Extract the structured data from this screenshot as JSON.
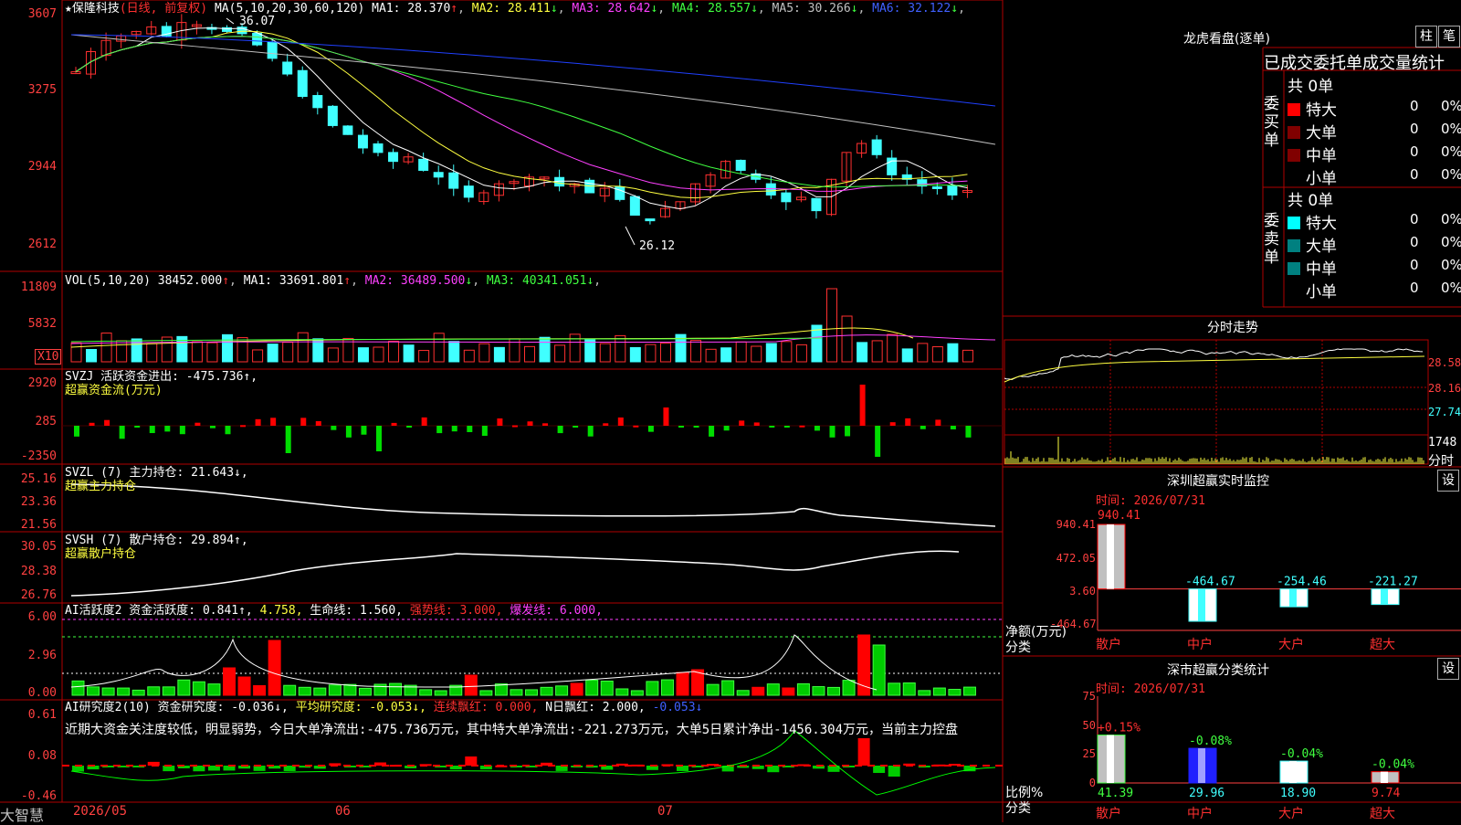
{
  "app": {
    "brand": "大智慧"
  },
  "kline": {
    "title_stock": "★保隆科技",
    "title_mode": "(日线, 前复权)",
    "title_ma": "MA(5,10,20,30,60,120)",
    "ma_values": [
      {
        "label": "MA1:",
        "value": "28.370",
        "arrow": "↑",
        "color": "#ffffff"
      },
      {
        "label": "MA2:",
        "value": "28.411",
        "arrow": "↓",
        "color": "#ffff40"
      },
      {
        "label": "MA3:",
        "value": "28.642",
        "arrow": "↓",
        "color": "#ff40ff"
      },
      {
        "label": "MA4:",
        "value": "28.557",
        "arrow": "↓",
        "color": "#40ff40"
      },
      {
        "label": "MA5:",
        "value": "30.266",
        "arrow": "↓",
        "color": "#c0c0c0"
      },
      {
        "label": "MA6:",
        "value": "32.122",
        "arrow": "↓",
        "color": "#4060ff"
      }
    ],
    "yticks": [
      "3607",
      "3275",
      "2944",
      "2612"
    ],
    "high_label": "36.07",
    "low_label": "26.12"
  },
  "vol": {
    "title": "VOL(5,10,20)",
    "value": "38452.000",
    "ma": [
      {
        "label": "MA1:",
        "value": "33691.801",
        "arrow": "↑",
        "color": "#ffffff"
      },
      {
        "label": "MA2:",
        "value": "36489.500",
        "arrow": "↓",
        "color": "#ff40ff"
      },
      {
        "label": "MA3:",
        "value": "40341.051",
        "arrow": "↓",
        "color": "#40ff40"
      }
    ],
    "yticks": [
      "11809",
      "5832"
    ],
    "unit": "X10"
  },
  "svzj": {
    "title": "SVZJ  活跃资金进出: -475.736↑,",
    "subtitle": "超赢资金流(万元)",
    "yticks": [
      "2920",
      "285",
      "-2350"
    ]
  },
  "svzl": {
    "title": "SVZL (7) 主力持仓: 21.643↓,",
    "subtitle": "超赢主力持仓",
    "yticks": [
      "25.16",
      "23.36",
      "21.56"
    ]
  },
  "svsh": {
    "title": "SVSH (7) 散户持仓: 29.894↑,",
    "subtitle": "超赢散户持仓",
    "yticks": [
      "30.05",
      "28.38",
      "26.76"
    ]
  },
  "ai1": {
    "t1": "AI活跃度2 资金活跃度: 0.841↑,",
    "t2": "4.758,",
    "t3": "生命线: 1.560,",
    "t4": "强势线: 3.000,",
    "t5": "爆发线: 6.000,",
    "yticks": [
      "6.00",
      "2.96",
      "0.00"
    ]
  },
  "ai2": {
    "t1": "AI研究度2(10) 资金研究度: -0.036↓,",
    "t2": "平均研究度: -0.053↓,",
    "t3": "连续飘红: 0.000,",
    "t4": "N日飘红: 2.000,",
    "t5": "-0.053↓",
    "comment": "近期大资金关注度较低，明显弱势，今日大单净流出:-475.736万元，其中特大单净流出:-221.273万元，大单5日累计净出-1456.304万元，当前主力控盘",
    "yticks": [
      "0.61",
      "0.08",
      "-0.46"
    ]
  },
  "xaxis": {
    "labels": [
      "2026/05",
      "06",
      "07"
    ]
  },
  "lhkp": {
    "title": "龙虎看盘(逐单)",
    "btn1": "柱",
    "btn2": "笔",
    "header": "已成交委托单成交量统计",
    "buy_label": "委买单",
    "sell_label": "委卖单",
    "buy_total": "共 0单",
    "sell_total": "共 0单",
    "buy_rows": [
      {
        "name": "特大",
        "count": "0",
        "pct": "0%",
        "color": "#ff0000"
      },
      {
        "name": "大单",
        "count": "0",
        "pct": "0%",
        "color": "#800000"
      },
      {
        "name": "中单",
        "count": "0",
        "pct": "0%",
        "color": "#800000"
      },
      {
        "name": "小单",
        "count": "0",
        "pct": "0%",
        "color": "#000000"
      }
    ],
    "sell_rows": [
      {
        "name": "特大",
        "count": "0",
        "pct": "0%",
        "color": "#00ffff"
      },
      {
        "name": "大单",
        "count": "0",
        "pct": "0%",
        "color": "#008080"
      },
      {
        "name": "中单",
        "count": "0",
        "pct": "0%",
        "color": "#008080"
      },
      {
        "name": "小单",
        "count": "0",
        "pct": "0%",
        "color": "#000000"
      }
    ]
  },
  "intraday": {
    "title": "分时走势",
    "ylabels": [
      "28.58",
      "28.16",
      "27.74"
    ],
    "vol_label": "1748",
    "unit": "分时"
  },
  "sz_monitor": {
    "title": "深圳超赢实时监控",
    "btn": "设",
    "time": "时间: 2026/07/31",
    "yticks": [
      "940.41",
      "472.05",
      "3.60",
      "-464.67"
    ],
    "ylabel1": "净额(万元)",
    "ylabel2": "分类",
    "bars": [
      {
        "cat": "散户",
        "value": 940.41,
        "label": "940.41"
      },
      {
        "cat": "中户",
        "value": -464.67,
        "label": "-464.67"
      },
      {
        "cat": "大户",
        "value": -254.46,
        "label": "-254.46"
      },
      {
        "cat": "超大",
        "value": -221.27,
        "label": "-221.27"
      }
    ]
  },
  "sz_class": {
    "title": "深市超赢分类统计",
    "btn": "设",
    "time": "时间: 2026/07/31",
    "yticks": [
      "75",
      "50",
      "25",
      "0"
    ],
    "ylabel1": "比例%",
    "ylabel2": "分类",
    "bars": [
      {
        "cat": "散户",
        "value": 41.39,
        "label": "41.39",
        "delta": "+0.15%"
      },
      {
        "cat": "中户",
        "value": 29.96,
        "label": "29.96",
        "delta": "-0.08%"
      },
      {
        "cat": "大户",
        "value": 18.9,
        "label": "18.90",
        "delta": "-0.04%"
      },
      {
        "cat": "超大",
        "value": 9.74,
        "label": "9.74",
        "delta": "-0.04%"
      }
    ]
  }
}
